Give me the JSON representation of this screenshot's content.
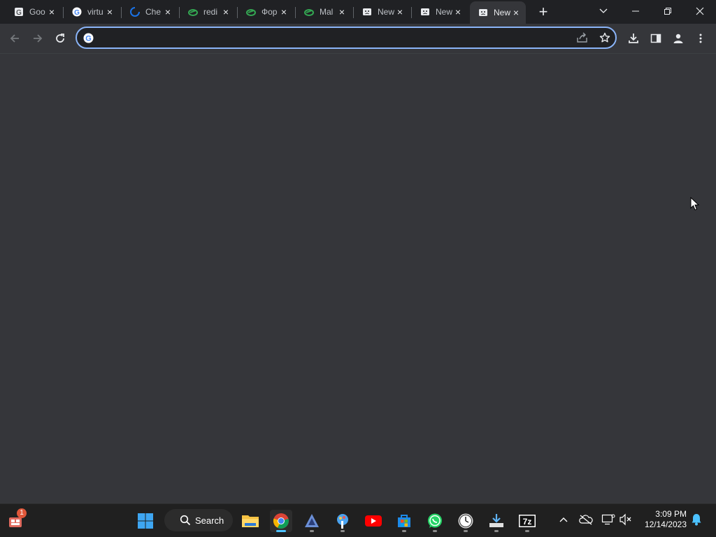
{
  "browser": {
    "tabs": [
      {
        "title": "Goo",
        "icon": "google-drive-icon",
        "active": false
      },
      {
        "title": "virtu",
        "icon": "google-icon",
        "active": false
      },
      {
        "title": "Che",
        "icon": "loading-icon",
        "active": false
      },
      {
        "title": "redi",
        "icon": "app-icon",
        "active": false
      },
      {
        "title": "Фор",
        "icon": "app-icon",
        "active": false
      },
      {
        "title": "Mal",
        "icon": "app-icon",
        "active": false
      },
      {
        "title": "New",
        "icon": "sad-tab-icon",
        "active": false
      },
      {
        "title": "New",
        "icon": "sad-tab-icon",
        "active": false
      },
      {
        "title": "New",
        "icon": "sad-tab-icon",
        "active": true
      }
    ],
    "close_glyph": "×",
    "new_tab_glyph": "+",
    "omnibox": {
      "value": "",
      "placeholder": ""
    }
  },
  "taskbar": {
    "search_label": "Search",
    "notification_badge": "1",
    "apps": [
      "start-icon",
      "file-explorer-icon",
      "chrome-icon",
      "app-icon",
      "paint-icon",
      "youtube-icon",
      "microsoft-store-icon",
      "whatsapp-icon",
      "clock-app-icon",
      "downloads-icon",
      "7zip-icon"
    ],
    "time": "3:09 PM",
    "date": "12/14/2023"
  },
  "colors": {
    "accent": "#8ab4f8",
    "tabstrip": "#202124",
    "toolbar": "#35363a",
    "taskbar": "#202020"
  }
}
